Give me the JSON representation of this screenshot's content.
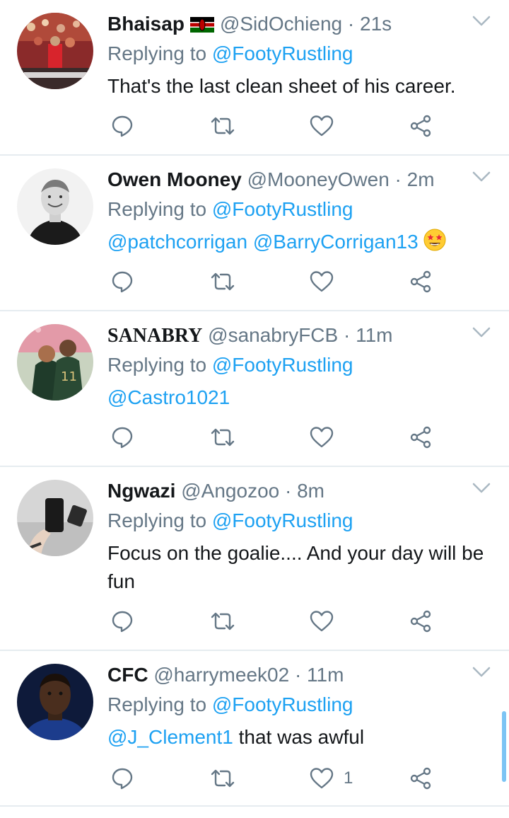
{
  "replying_prefix": "Replying to",
  "tweets": [
    {
      "name": "Bhaisap",
      "handle": "@SidOchieng",
      "time": "· 21s",
      "reply_to": "@FootyRustling",
      "text_mentions": "",
      "text": "That's the last clean sheet of his career.",
      "like_count": ""
    },
    {
      "name": "Owen Mooney",
      "handle": "@MooneyOwen",
      "time": "· 2m",
      "reply_to": "@FootyRustling",
      "text_mentions": "@patchcorrigan @BarryCorrigan13",
      "text": "",
      "like_count": ""
    },
    {
      "name": "SANABRY",
      "handle": "@sanabryFCB",
      "time": "· 11m",
      "reply_to": "@FootyRustling",
      "text_mentions": "@Castro1021",
      "text": "",
      "like_count": ""
    },
    {
      "name": "Ngwazi",
      "handle": "@Angozoo",
      "time": "· 8m",
      "reply_to": "@FootyRustling",
      "text_mentions": "",
      "text": "Focus on the goalie.... And your day will be fun",
      "like_count": ""
    },
    {
      "name": "CFC",
      "handle": "@harrymeek02",
      "time": "· 11m",
      "reply_to": "@FootyRustling",
      "text_mentions": "@J_Clement1",
      "text": "that was awful",
      "like_count": "1"
    }
  ],
  "icons": {
    "reply": "reply-icon",
    "retweet": "retweet-icon",
    "like": "heart-icon",
    "share": "share-icon",
    "more": "chevron-down-icon",
    "flag": "kenya-flag-icon",
    "emoji": "star-struck-emoji-icon"
  },
  "colors": {
    "link": "#1da1f2",
    "secondary_text": "#657786",
    "divider": "#e6ecf0",
    "scrollbar": "#7cc4f4"
  }
}
